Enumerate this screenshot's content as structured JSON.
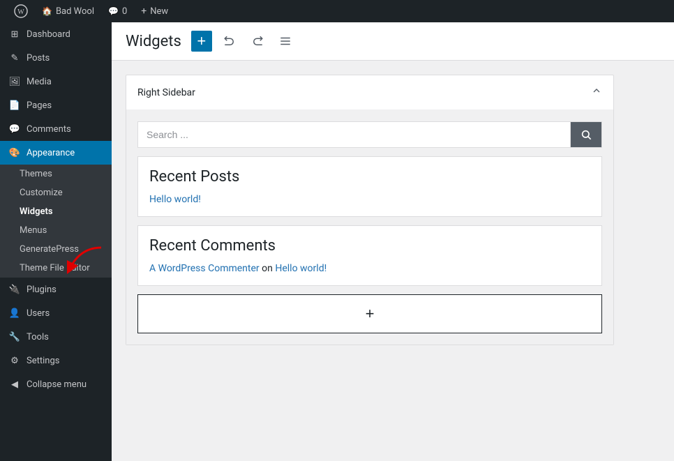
{
  "adminBar": {
    "wpLogoLabel": "WordPress",
    "siteName": "Bad Wool",
    "comments": "0",
    "newLabel": "New"
  },
  "sidebar": {
    "items": [
      {
        "id": "dashboard",
        "label": "Dashboard",
        "icon": "⊞"
      },
      {
        "id": "posts",
        "label": "Posts",
        "icon": "✎"
      },
      {
        "id": "media",
        "label": "Media",
        "icon": "⬛"
      },
      {
        "id": "pages",
        "label": "Pages",
        "icon": "▭"
      },
      {
        "id": "comments",
        "label": "Comments",
        "icon": "💬"
      }
    ],
    "appearance": {
      "label": "Appearance",
      "subItems": [
        {
          "id": "themes",
          "label": "Themes"
        },
        {
          "id": "customize",
          "label": "Customize"
        },
        {
          "id": "widgets",
          "label": "Widgets",
          "active": true
        },
        {
          "id": "menus",
          "label": "Menus"
        },
        {
          "id": "generatepress",
          "label": "GeneratePress"
        },
        {
          "id": "theme-file-editor",
          "label": "Theme File Editor"
        }
      ]
    },
    "bottomItems": [
      {
        "id": "plugins",
        "label": "Plugins",
        "icon": "⚙"
      },
      {
        "id": "users",
        "label": "Users",
        "icon": "👤"
      },
      {
        "id": "tools",
        "label": "Tools",
        "icon": "🔧"
      },
      {
        "id": "settings",
        "label": "Settings",
        "icon": "⚙"
      },
      {
        "id": "collapse",
        "label": "Collapse menu",
        "icon": "◀"
      }
    ]
  },
  "header": {
    "title": "Widgets",
    "addButton": "+",
    "undoTitle": "Undo",
    "redoTitle": "Redo",
    "listViewTitle": "List View"
  },
  "widgetPanel": {
    "sidebarTitle": "Right Sidebar",
    "search": {
      "placeholder": "Search ...",
      "buttonIcon": "🔍"
    },
    "recentPosts": {
      "title": "Recent Posts",
      "items": [
        {
          "label": "Hello world!",
          "href": "#"
        }
      ]
    },
    "recentComments": {
      "title": "Recent Comments",
      "commenter": "A WordPress Commenter",
      "on": "on",
      "post": "Hello world!"
    },
    "addBlockLabel": "+"
  }
}
